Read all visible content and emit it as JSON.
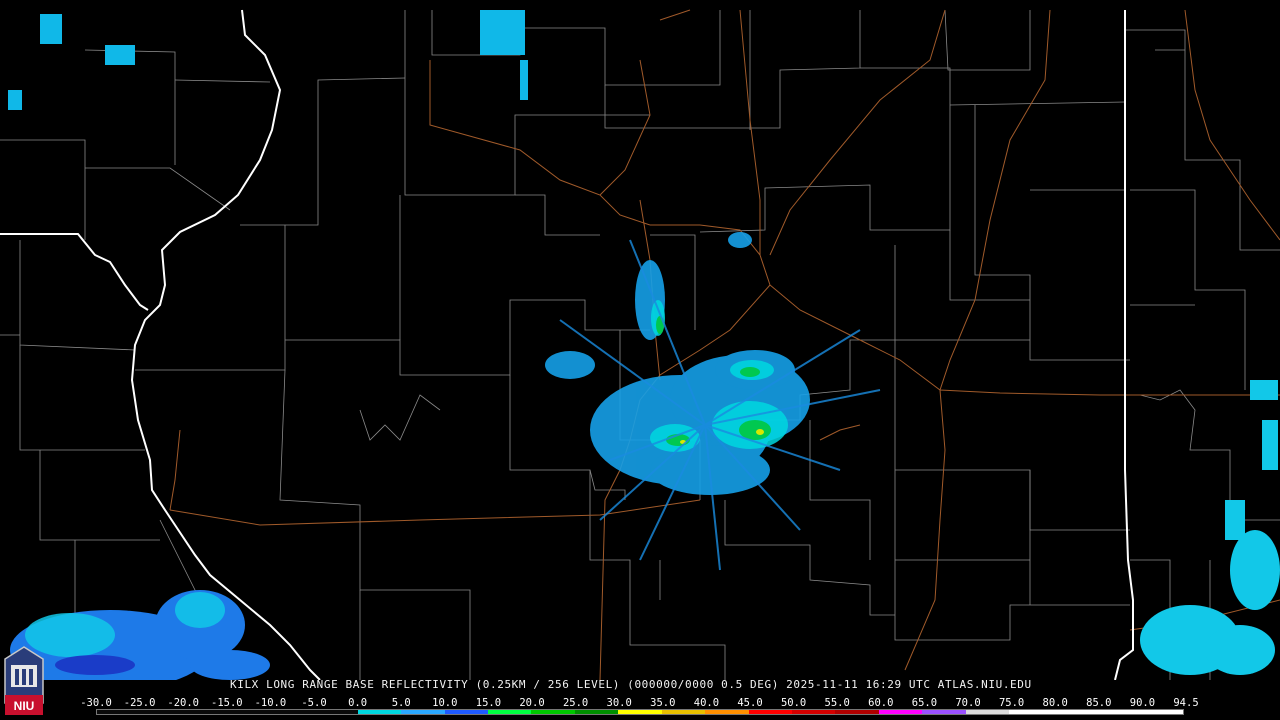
{
  "product_title": "KILX LONG RANGE BASE REFLECTIVITY (0.25KM / 256 LEVEL) (000000/0000 0.5 DEG) 2025-11-11 16:29 UTC  ATLAS.NIU.EDU",
  "logo": {
    "text": "NIU",
    "icon": "niu-seal-icon"
  },
  "colors": {
    "state_border": "#ffffff",
    "county_line": "#8a8a8a",
    "highway": "#a05a2a",
    "background": "#000000"
  },
  "scale": {
    "labels": [
      "-30.0",
      "-25.0",
      "-20.0",
      "-15.0",
      "-10.0",
      "-5.0",
      "0.0",
      "5.0",
      "10.0",
      "15.0",
      "20.0",
      "25.0",
      "30.0",
      "35.0",
      "40.0",
      "45.0",
      "50.0",
      "55.0",
      "60.0",
      "65.0",
      "70.0",
      "75.0",
      "80.0",
      "85.0",
      "90.0",
      "94.5"
    ],
    "segment_colors": [
      "#0a0a0a",
      "#0a0a0a",
      "#0a0a0a",
      "#0a0a0a",
      "#0a0a0a",
      "#0a0a0a",
      "#00d8e0",
      "#2aa8ff",
      "#1e5aff",
      "#00ff40",
      "#00c800",
      "#009000",
      "#ffff00",
      "#e8c000",
      "#ff9000",
      "#ff0000",
      "#d40000",
      "#b00000",
      "#ff00ff",
      "#9a50ff",
      "#dcdcdc",
      "#ffffff",
      "#ffffff",
      "#ffffff",
      "#ffffff"
    ]
  }
}
